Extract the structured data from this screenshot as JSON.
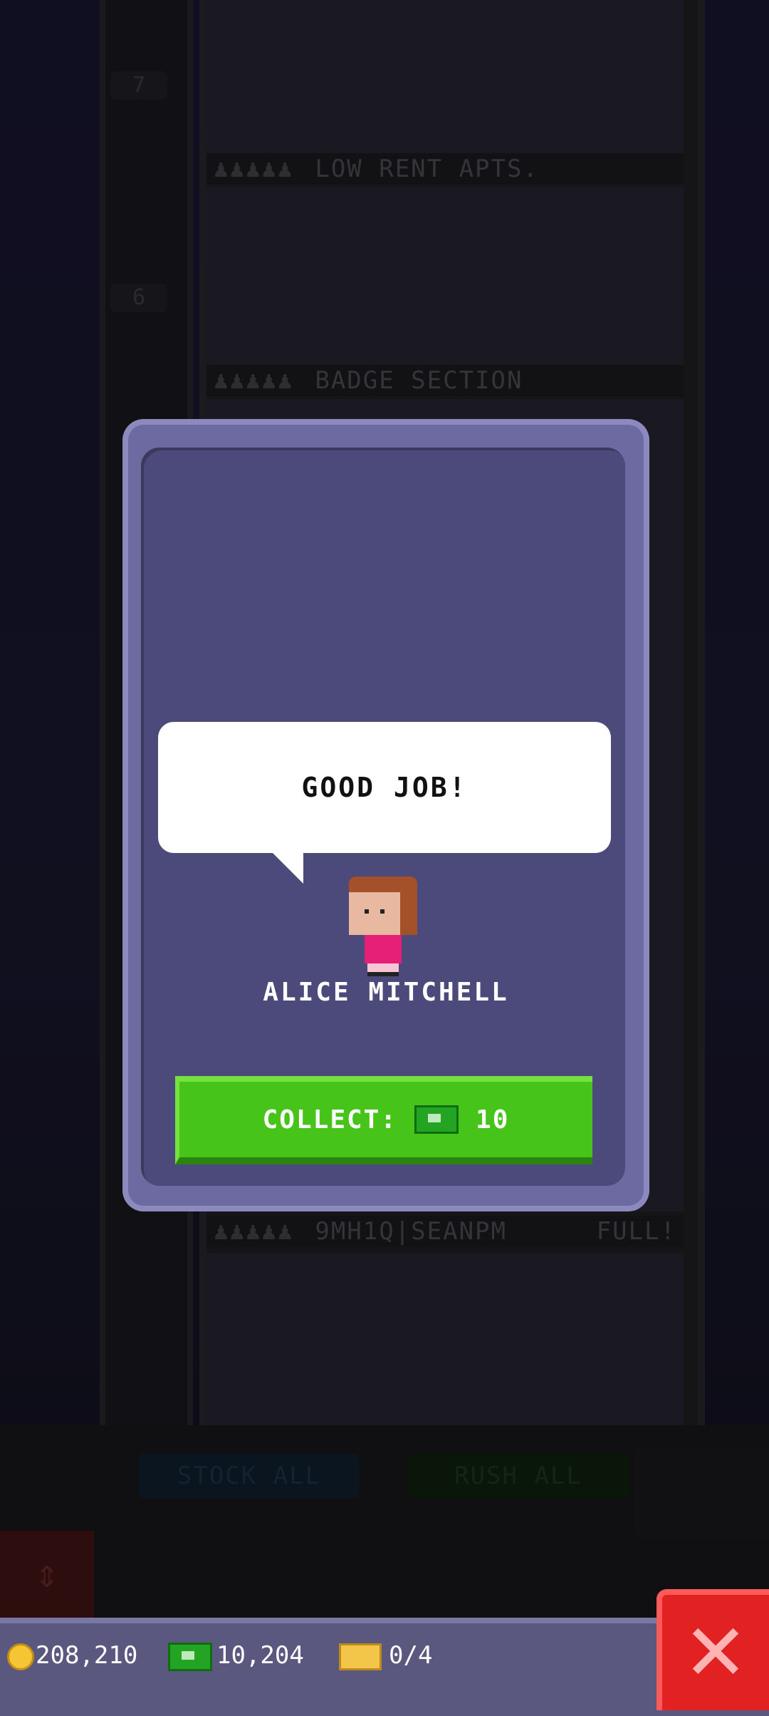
{
  "background": {
    "floor_numbers": [
      "7",
      "6"
    ],
    "floor_signs": [
      {
        "name": "LOW RENT APTS.",
        "status": ""
      },
      {
        "name": "BADGE SECTION",
        "status": ""
      },
      {
        "name": "9MH1Q|SEANPM",
        "status": "FULL!"
      }
    ],
    "residents_dots": "♟♟♟♟♟",
    "stock_all_label": "STOCK ALL",
    "rush_all_label": "RUSH ALL"
  },
  "dialog": {
    "speech": "GOOD JOB!",
    "character_name": "ALICE MITCHELL",
    "collect_label": "COLLECT:",
    "collect_amount": "10"
  },
  "status_bar": {
    "coins": "208,210",
    "bux": "10,204",
    "tickets": "0/4"
  },
  "icons": {
    "coin": "coin-icon",
    "bux": "bux-icon",
    "ticket": "ticket-icon",
    "close": "close-icon"
  },
  "colors": {
    "dialog_frame": "#6c6aa1",
    "dialog_inner": "#4c4a7a",
    "collect_green": "#46c41a",
    "close_red": "#e22222",
    "status_bar": "#5a587f"
  }
}
